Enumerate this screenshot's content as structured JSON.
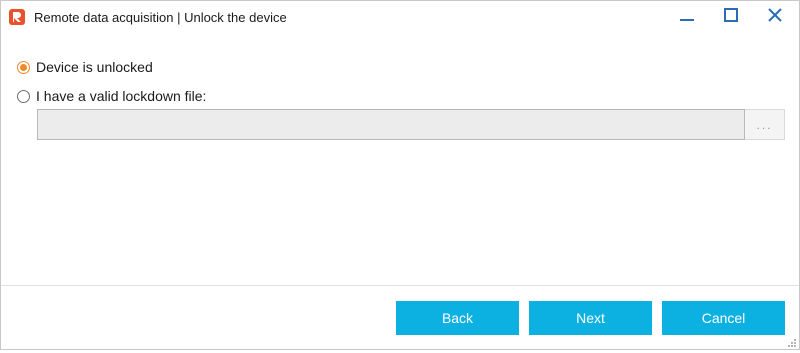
{
  "window": {
    "title": "Remote data acquisition | Unlock the device"
  },
  "options": {
    "device_unlocked_label": "Device is unlocked",
    "lockdown_file_label": "I have a valid lockdown file:",
    "selected": "device_unlocked"
  },
  "lockdown_file": {
    "value": "",
    "browse_label": "..."
  },
  "buttons": {
    "back": "Back",
    "next": "Next",
    "cancel": "Cancel"
  },
  "colors": {
    "accent": "#f0892b",
    "button": "#0cb1e2",
    "app_icon": "#e8512a"
  },
  "icons": {
    "app": "app-logo-icon",
    "minimize": "minimize-icon",
    "maximize": "maximize-icon",
    "close": "close-icon",
    "resize": "resize-grip-icon"
  }
}
